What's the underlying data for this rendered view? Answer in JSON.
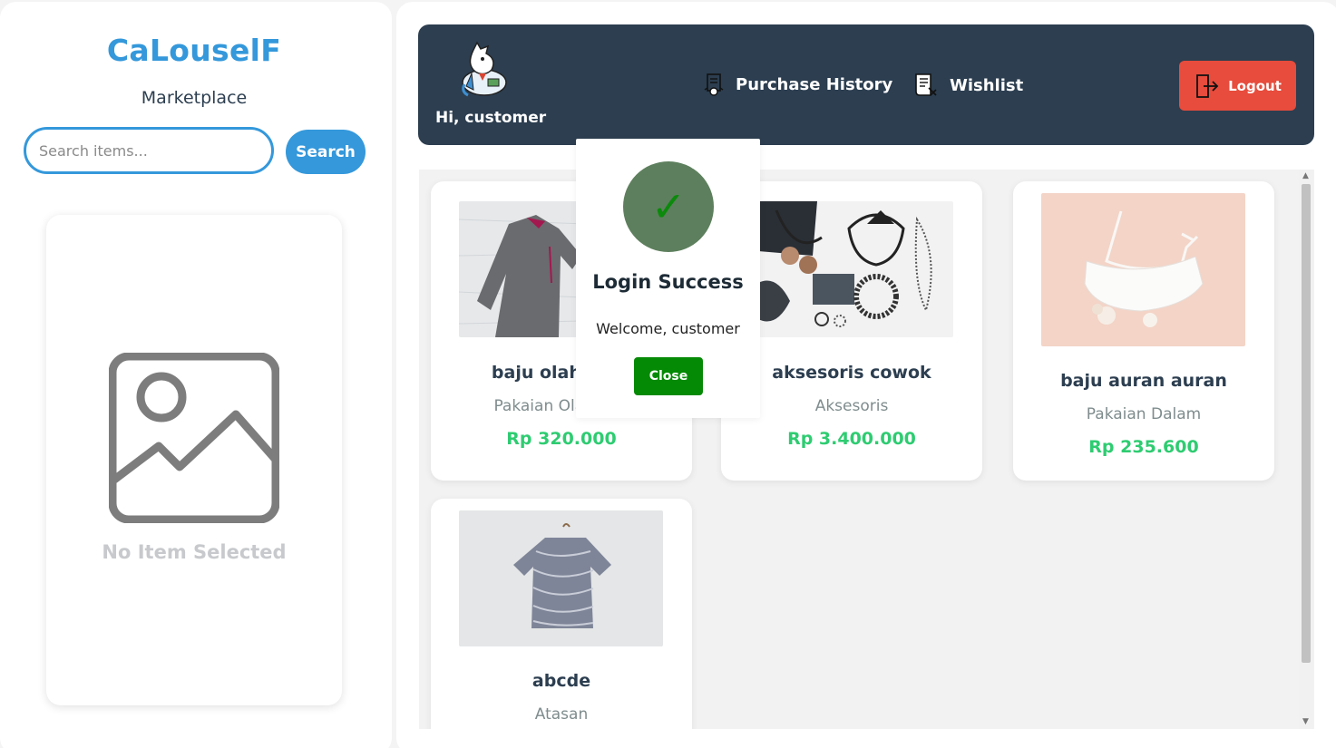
{
  "brand": {
    "title": "CaLouselF",
    "subtitle": "Marketplace"
  },
  "search": {
    "placeholder": "Search items...",
    "value": "",
    "button_label": "Search"
  },
  "detail": {
    "empty_text": "No Item Selected",
    "icon": "image-placeholder-icon"
  },
  "navbar": {
    "greeting": "Hi, customer",
    "links": [
      {
        "label": "Purchase History",
        "icon": "purchase-history-icon"
      },
      {
        "label": "Wishlist",
        "icon": "wishlist-icon"
      }
    ],
    "logout_label": "Logout",
    "colors": {
      "navbar_bg": "#2c3e50",
      "logout_bg": "#e74c3c"
    }
  },
  "products": [
    {
      "name": "baju olah raga",
      "category": "Pakaian Olahraga",
      "price": "Rp 320.000",
      "image": "grey-sport-shirt"
    },
    {
      "name": "aksesoris cowok",
      "category": "Aksesoris",
      "price": "Rp 3.400.000",
      "image": "accessories-flatlay"
    },
    {
      "name": "baju auran auran",
      "category": "Pakaian Dalam",
      "price": "Rp 235.600",
      "image": "white-bralette"
    },
    {
      "name": "abcde",
      "category": "Atasan",
      "price": "",
      "image": "striped-blouse"
    }
  ],
  "modal": {
    "title": "Login Success",
    "message": "Welcome, customer",
    "close_label": "Close",
    "check": "✓"
  },
  "colors": {
    "accent": "#3498db",
    "price": "#2ecc71",
    "success": "#058a05"
  }
}
